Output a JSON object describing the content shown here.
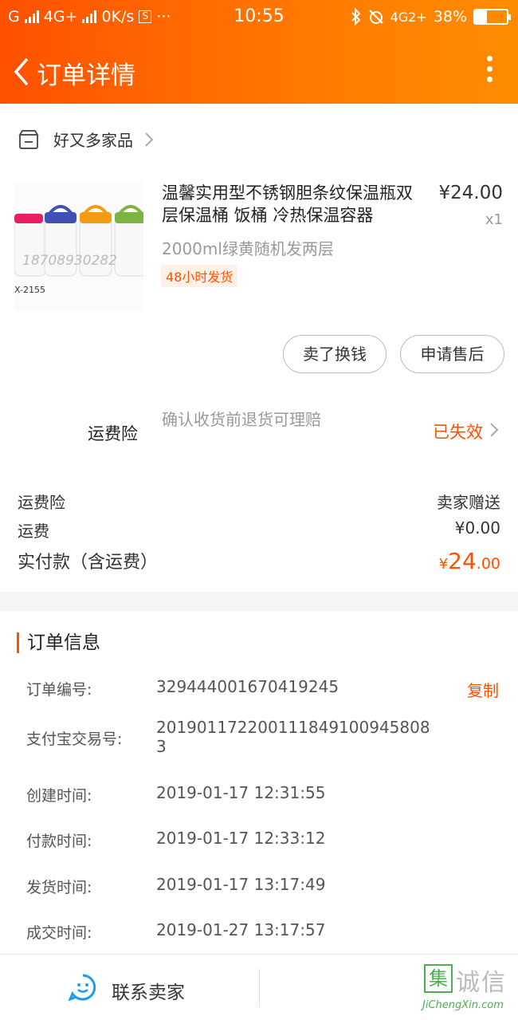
{
  "status_bar": {
    "carrier": "G",
    "network1": "4G+",
    "speed": "0K/s",
    "sim_icon": "S",
    "dots": "···",
    "time": "10:55",
    "network2": "4G2+",
    "battery": "38%"
  },
  "nav": {
    "title": "订单详情"
  },
  "shop": {
    "name": "好又多家品"
  },
  "product": {
    "name": "温馨实用型不锈钢胆条纹保温瓶双层保温桶 饭桶 冷热保温容器",
    "price": "¥24.00",
    "qty": "x1",
    "sku": "2000ml绿黄随机发两层",
    "ship_tag": "48小时发货",
    "image_code": "X-2155",
    "image_watermark": "18708930282"
  },
  "actions": {
    "sell_label": "卖了换钱",
    "after_sale_label": "申请售后"
  },
  "insurance": {
    "label": "运费险",
    "desc": "确认收货前退货可理赔",
    "status": "已失效"
  },
  "fees": {
    "ins_label": "运费险",
    "ins_value": "卖家赠送",
    "freight_label": "运费",
    "freight_value": "¥0.00",
    "total_label": "实付款（含运费）",
    "total_symbol": "¥",
    "total_int": "24",
    "total_dec": ".00"
  },
  "order_info": {
    "title": "订单信息",
    "copy_label": "复制",
    "rows": [
      {
        "label": "订单编号:",
        "value": "329444001670419245"
      },
      {
        "label": "支付宝交易号:",
        "value": "2019011722001118491009458083"
      },
      {
        "label": "创建时间:",
        "value": "2019-01-17 12:31:55"
      },
      {
        "label": "付款时间:",
        "value": "2019-01-17 12:33:12"
      },
      {
        "label": "发货时间:",
        "value": "2019-01-17 13:17:49"
      },
      {
        "label": "成交时间:",
        "value": "2019-01-27 13:17:57"
      }
    ]
  },
  "bottom": {
    "contact_label": "联系卖家"
  },
  "watermark": {
    "box_char": "集",
    "cn": "诚信",
    "en": "JiChengXin.com"
  },
  "colors": {
    "brand": "#ff5000",
    "header_end": "#ff8c00"
  }
}
